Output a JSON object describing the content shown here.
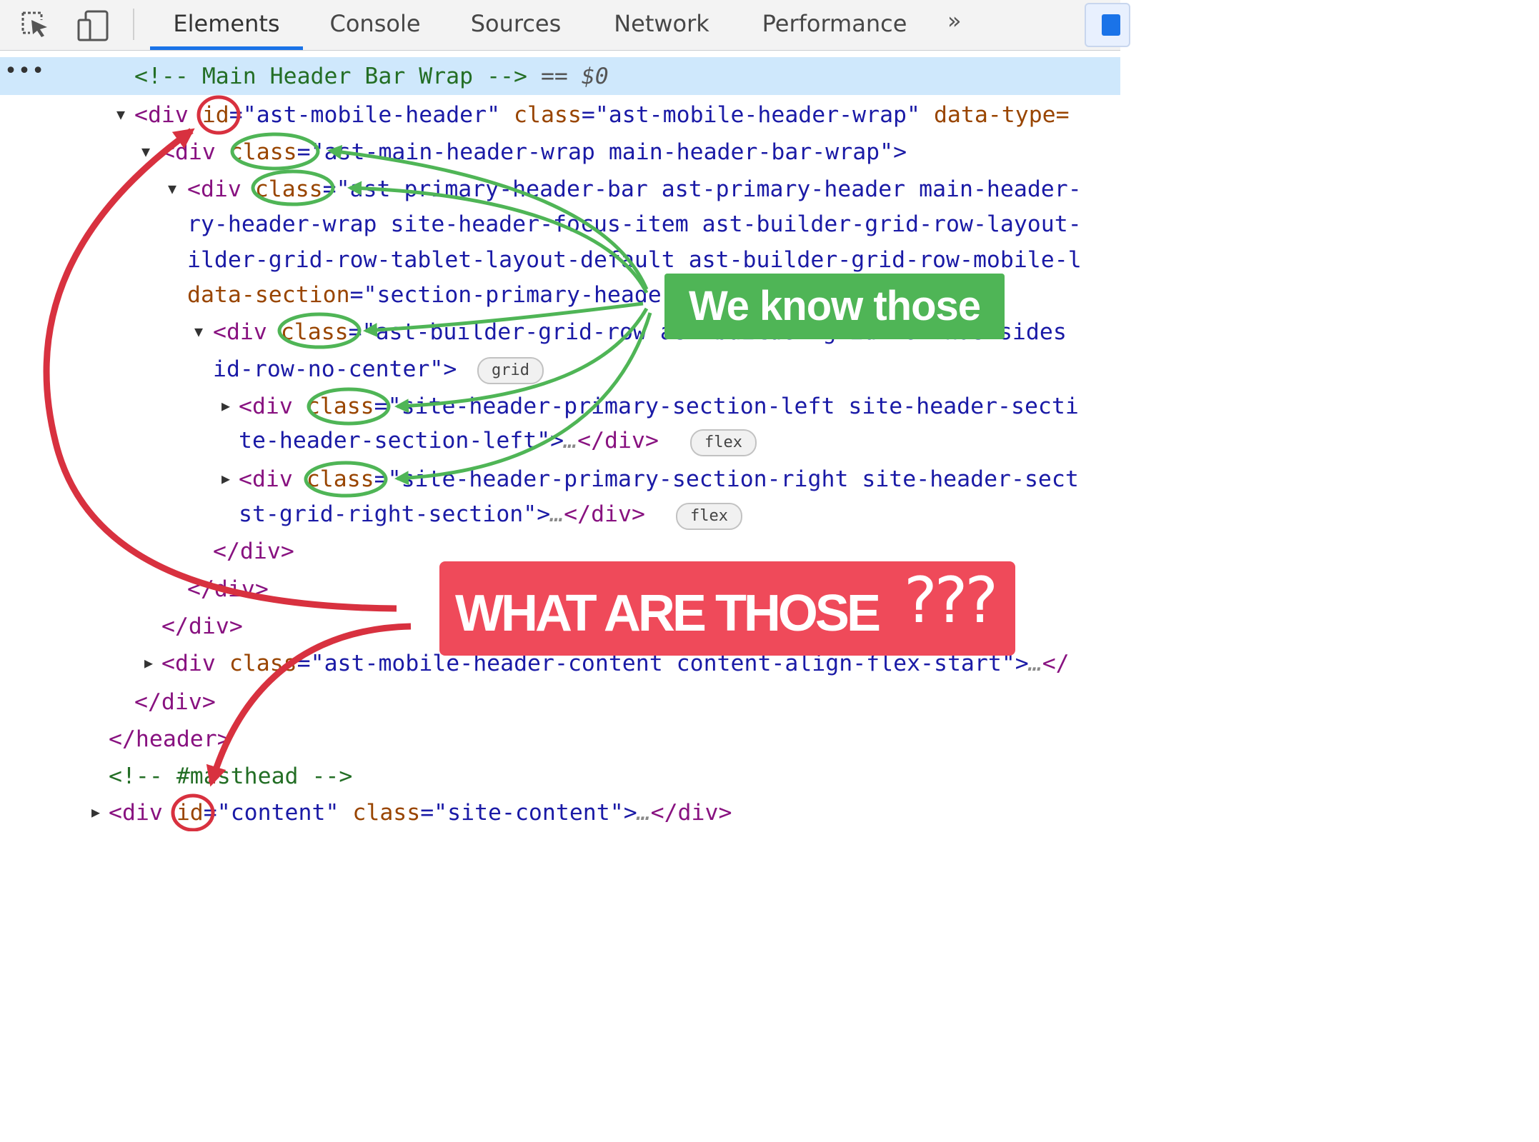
{
  "devtools": {
    "tabs": [
      "Elements",
      "Console",
      "Sources",
      "Network",
      "Performance"
    ],
    "more_tabs": "»",
    "selected_comment": "<!-- Main Header Bar Wrap -->",
    "selected_marker": "== $0",
    "row_dots": "•••",
    "lines": [
      {
        "t": [
          [
            "<div ",
            "tag"
          ],
          [
            "id",
            "attr"
          ],
          [
            "=\"ast-mobile-header\" ",
            "val"
          ],
          [
            "class",
            "attr"
          ],
          [
            "=\"ast-mobile-header-wrap\" ",
            "val"
          ],
          [
            "data-type=",
            "attr"
          ]
        ]
      },
      {
        "t": [
          [
            "<div ",
            "tag"
          ],
          [
            "class",
            "attr"
          ],
          [
            "=\"ast-main-header-wrap main-header-bar-wrap\">",
            "val"
          ]
        ]
      },
      {
        "t": [
          [
            "<div ",
            "tag"
          ],
          [
            "class",
            "attr"
          ],
          [
            "=\"ast-primary-header-bar ast-primary-header main-header-",
            "val"
          ]
        ]
      },
      {
        "t": [
          [
            "ry-header-wrap site-header-focus-item ast-builder-grid-row-layout-",
            "val"
          ]
        ]
      },
      {
        "t": [
          [
            "ilder-grid-row-tablet-layout-default ast-builder-grid-row-mobile-l",
            "val"
          ]
        ]
      },
      {
        "t": [
          [
            "data-section",
            "attr"
          ],
          [
            "=\"section-primary-header-builder\">",
            "val"
          ]
        ]
      },
      {
        "t": [
          [
            "<div ",
            "tag"
          ],
          [
            "class",
            "attr"
          ],
          [
            "=\"ast-builder-grid-row ast-builder-grid-row-has-sides",
            "val"
          ]
        ]
      },
      {
        "t": [
          [
            "id-row-no-center\">",
            "val"
          ]
        ]
      },
      {
        "t": [
          [
            "<div ",
            "tag"
          ],
          [
            "class",
            "attr"
          ],
          [
            "=\"site-header-primary-section-left site-header-secti",
            "val"
          ]
        ]
      },
      {
        "t": [
          [
            "te-header-section-left\">",
            "val"
          ],
          [
            "…",
            "hint"
          ],
          [
            "</div>",
            "tag"
          ]
        ]
      },
      {
        "t": [
          [
            "<div ",
            "tag"
          ],
          [
            "class",
            "attr"
          ],
          [
            "=\"site-header-primary-section-right site-header-sect",
            "val"
          ]
        ]
      },
      {
        "t": [
          [
            "st-grid-right-section\">",
            "val"
          ],
          [
            "…",
            "hint"
          ],
          [
            "</div>",
            "tag"
          ]
        ]
      },
      {
        "t": [
          [
            "</div>",
            "tag"
          ]
        ]
      },
      {
        "t": [
          [
            "</div>",
            "tag"
          ]
        ]
      },
      {
        "t": [
          [
            "</div>",
            "tag"
          ]
        ]
      },
      {
        "t": [
          [
            "<div ",
            "tag"
          ],
          [
            "class",
            "attr"
          ],
          [
            "=\"ast-mobile-header-content content-align-flex-start\">",
            "val"
          ],
          [
            "…",
            "hint"
          ],
          [
            "</",
            "tag"
          ]
        ]
      },
      {
        "t": [
          [
            "</div>",
            "tag"
          ]
        ]
      },
      {
        "t": [
          [
            "</header>",
            "tag"
          ]
        ]
      },
      {
        "t": [
          [
            "<!-- #masthead -->",
            "comment"
          ]
        ]
      },
      {
        "t": [
          [
            "<div ",
            "tag"
          ],
          [
            "id",
            "attr"
          ],
          [
            "=\"content\" ",
            "val"
          ],
          [
            "class",
            "attr"
          ],
          [
            "=\"site-content\">",
            "val"
          ],
          [
            "…",
            "hint"
          ],
          [
            "</div>",
            "tag"
          ]
        ]
      }
    ],
    "badges": [
      "grid",
      "flex",
      "flex"
    ]
  },
  "annotations": {
    "green_label": "We know those",
    "red_label": "WHAT ARE THOSE",
    "red_suffix": "???",
    "green_color": "#4fb556",
    "red_color": "#d8313f"
  }
}
